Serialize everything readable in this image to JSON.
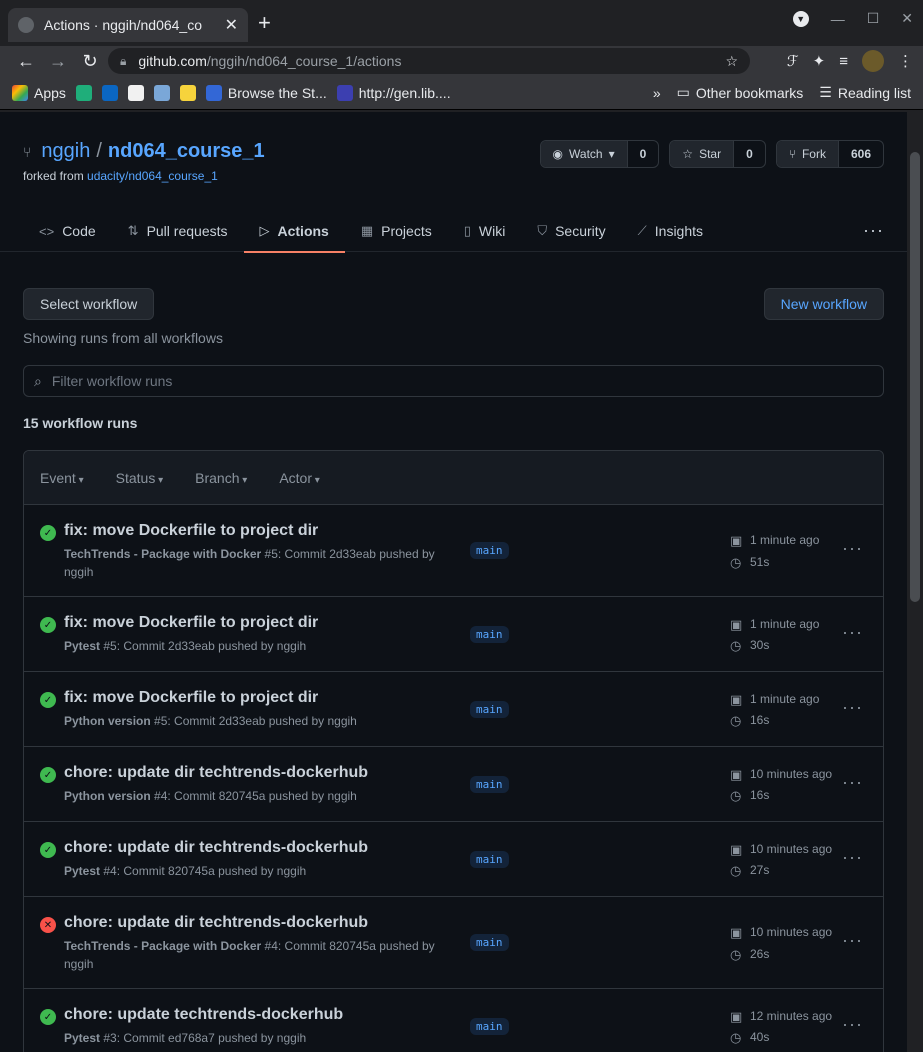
{
  "browser": {
    "tab_title": "Actions · nggih/nd064_co",
    "url_host": "github.com",
    "url_path": "/nggih/nd064_course_1/actions",
    "bookmarks": [
      "Apps",
      "Browse the St...",
      "http://gen.lib...."
    ],
    "other_bookmarks": "Other bookmarks",
    "reading_list": "Reading list"
  },
  "repo": {
    "owner": "nggih",
    "separator": "/",
    "name": "nd064_course_1",
    "forked_from_label": "forked from",
    "forked_from": "udacity/nd064_course_1",
    "watch_label": "Watch",
    "watch_count": "0",
    "star_label": "Star",
    "star_count": "0",
    "fork_label": "Fork",
    "fork_count": "606"
  },
  "nav": [
    {
      "label": "Code",
      "icon": "code-icon"
    },
    {
      "label": "Pull requests",
      "icon": "pull-request-icon"
    },
    {
      "label": "Actions",
      "icon": "play-icon"
    },
    {
      "label": "Projects",
      "icon": "project-icon"
    },
    {
      "label": "Wiki",
      "icon": "book-icon"
    },
    {
      "label": "Security",
      "icon": "shield-icon"
    },
    {
      "label": "Insights",
      "icon": "graph-icon"
    }
  ],
  "actions": {
    "select_workflow": "Select workflow",
    "new_workflow": "New workflow",
    "showing": "Showing runs from all workflows",
    "filter_placeholder": "Filter workflow runs",
    "run_count": "15 workflow runs",
    "filters": [
      "Event",
      "Status",
      "Branch",
      "Actor"
    ]
  },
  "runs": [
    {
      "status": "success",
      "title": "fix: move Dockerfile to project dir",
      "workflow": "TechTrends - Package with Docker",
      "detail": " #5: Commit 2d33eab pushed by nggih",
      "branch": "main",
      "when": "1 minute ago",
      "duration": "51s"
    },
    {
      "status": "success",
      "title": "fix: move Dockerfile to project dir",
      "workflow": "Pytest",
      "detail": " #5: Commit 2d33eab pushed by nggih",
      "branch": "main",
      "when": "1 minute ago",
      "duration": "30s"
    },
    {
      "status": "success",
      "title": "fix: move Dockerfile to project dir",
      "workflow": "Python version",
      "detail": " #5: Commit 2d33eab pushed by nggih",
      "branch": "main",
      "when": "1 minute ago",
      "duration": "16s"
    },
    {
      "status": "success",
      "title": "chore: update dir techtrends-dockerhub",
      "workflow": "Python version",
      "detail": " #4: Commit 820745a pushed by nggih",
      "branch": "main",
      "when": "10 minutes ago",
      "duration": "16s"
    },
    {
      "status": "success",
      "title": "chore: update dir techtrends-dockerhub",
      "workflow": "Pytest",
      "detail": " #4: Commit 820745a pushed by nggih",
      "branch": "main",
      "when": "10 minutes ago",
      "duration": "27s"
    },
    {
      "status": "failure",
      "title": "chore: update dir techtrends-dockerhub",
      "workflow": "TechTrends - Package with Docker",
      "detail": " #4: Commit 820745a pushed by nggih",
      "branch": "main",
      "when": "10 minutes ago",
      "duration": "26s"
    },
    {
      "status": "success",
      "title": "chore: update techtrends-dockerhub",
      "workflow": "Pytest",
      "detail": " #3: Commit ed768a7 pushed by nggih",
      "branch": "main",
      "when": "12 minutes ago",
      "duration": "40s"
    }
  ]
}
